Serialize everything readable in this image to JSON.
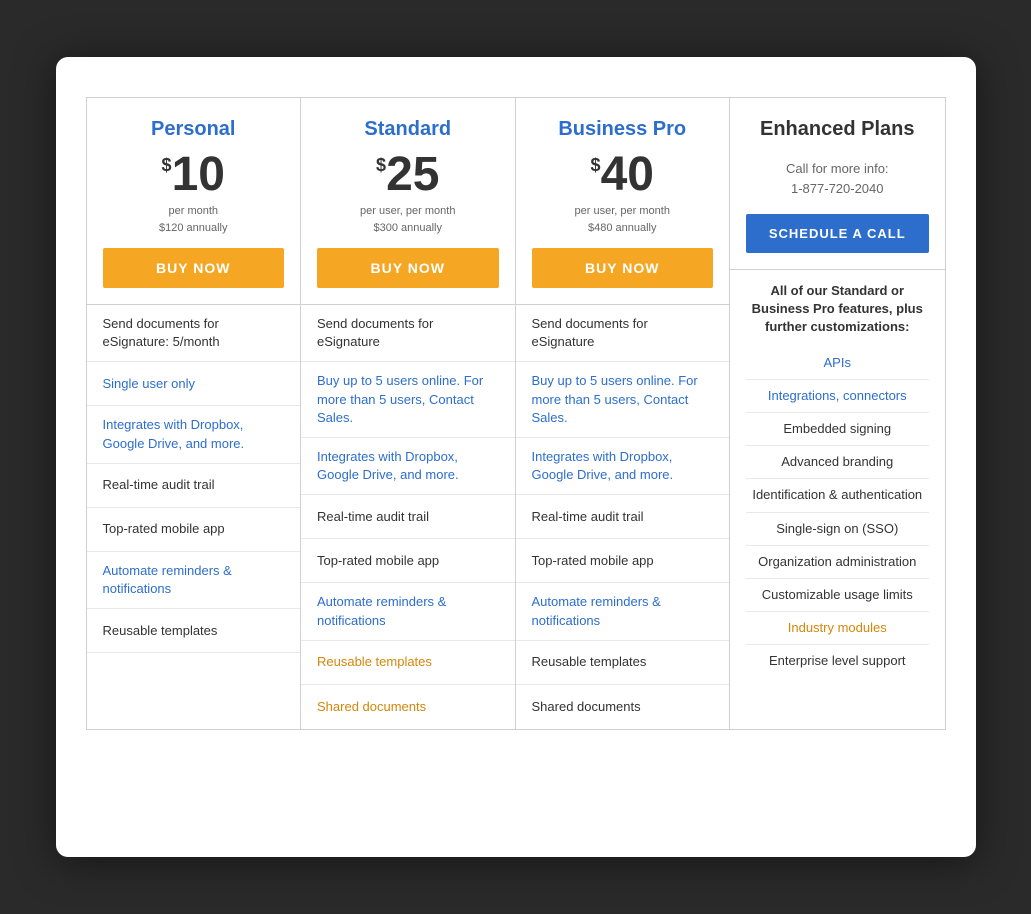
{
  "plans": [
    {
      "id": "personal",
      "name": "Personal",
      "name_color": "blue",
      "price_symbol": "$",
      "price": "10",
      "price_period": "per month",
      "price_annual": "$120 annually",
      "btn_label": "BUY NOW",
      "btn_type": "buy",
      "features": [
        {
          "text": "Send documents for eSignature: 5/month",
          "style": "normal"
        },
        {
          "text": "Single user only",
          "style": "blue"
        },
        {
          "text": "Integrates with Dropbox, Google Drive, and more.",
          "style": "blue"
        },
        {
          "text": "Real-time audit trail",
          "style": "normal"
        },
        {
          "text": "Top-rated mobile app",
          "style": "normal"
        },
        {
          "text": "Automate reminders & notifications",
          "style": "blue"
        },
        {
          "text": "Reusable templates",
          "style": "normal"
        },
        {
          "text": "",
          "style": "empty"
        }
      ]
    },
    {
      "id": "standard",
      "name": "Standard",
      "name_color": "blue",
      "price_symbol": "$",
      "price": "25",
      "price_period": "per user, per month",
      "price_annual": "$300 annually",
      "btn_label": "BUY NOW",
      "btn_type": "buy",
      "features": [
        {
          "text": "Send documents for eSignature",
          "style": "normal"
        },
        {
          "text": "Buy up to 5 users online. For more than 5 users, Contact Sales.",
          "style": "blue"
        },
        {
          "text": "Integrates with Dropbox, Google Drive, and more.",
          "style": "blue"
        },
        {
          "text": "Real-time audit trail",
          "style": "normal"
        },
        {
          "text": "Top-rated mobile app",
          "style": "normal"
        },
        {
          "text": "Automate reminders & notifications",
          "style": "blue"
        },
        {
          "text": "Reusable templates",
          "style": "orange"
        },
        {
          "text": "Shared documents",
          "style": "orange"
        }
      ]
    },
    {
      "id": "business-pro",
      "name": "Business Pro",
      "name_color": "blue",
      "price_symbol": "$",
      "price": "40",
      "price_period": "per user, per month",
      "price_annual": "$480 annually",
      "btn_label": "BUY NOW",
      "btn_type": "buy",
      "features": [
        {
          "text": "Send documents for eSignature",
          "style": "normal"
        },
        {
          "text": "Buy up to 5 users online. For more than 5 users, Contact Sales.",
          "style": "blue"
        },
        {
          "text": "Integrates with Dropbox, Google Drive, and more.",
          "style": "blue"
        },
        {
          "text": "Real-time audit trail",
          "style": "normal"
        },
        {
          "text": "Top-rated mobile app",
          "style": "normal"
        },
        {
          "text": "Automate reminders & notifications",
          "style": "blue"
        },
        {
          "text": "Reusable templates",
          "style": "normal"
        },
        {
          "text": "Shared documents",
          "style": "normal"
        }
      ]
    }
  ],
  "enhanced": {
    "name": "Enhanced Plans",
    "call_label": "Call for more info:",
    "phone": "1-877-720-2040",
    "btn_label": "SCHEDULE A CALL",
    "intro": "All of our Standard or Business Pro features, plus further customizations:",
    "features": [
      {
        "text": "APIs",
        "style": "blue"
      },
      {
        "text": "Integrations, connectors",
        "style": "blue"
      },
      {
        "text": "Embedded signing",
        "style": "dark"
      },
      {
        "text": "Advanced branding",
        "style": "dark"
      },
      {
        "text": "Identification & authentication",
        "style": "dark"
      },
      {
        "text": "Single-sign on (SSO)",
        "style": "dark"
      },
      {
        "text": "Organization administration",
        "style": "dark"
      },
      {
        "text": "Customizable usage limits",
        "style": "dark"
      },
      {
        "text": "Industry modules",
        "style": "orange"
      },
      {
        "text": "Enterprise level support",
        "style": "dark"
      }
    ]
  }
}
